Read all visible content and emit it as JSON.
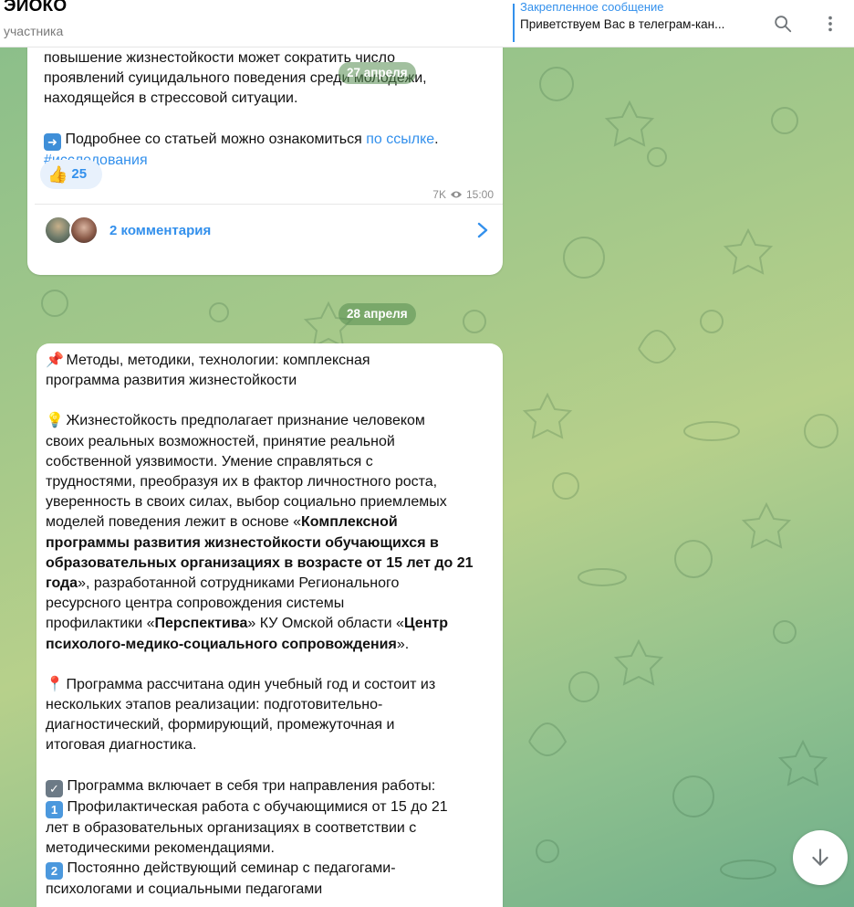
{
  "header": {
    "title": "ЭИОКО",
    "subtitle": "участника",
    "pinned_title": "Закрепленное сообщение",
    "pinned_text": "Приветствуем Вас в телеграм-кан...",
    "icons": [
      "search-icon",
      "more-vert-icon"
    ]
  },
  "message1": {
    "lines": [
      "повышение жизнестойкости может сократить число",
      "проявлений суицидального поведения среди молодежи,",
      "находящейся в стрессовой ситуации."
    ],
    "more_prefix": "Подробнее со статьей можно ознакомиться ",
    "more_link": "по ссылке",
    "more_suffix": ".",
    "hashtag": "#исследования",
    "reaction_emoji": "👍",
    "reaction_count": "25",
    "views": "7K",
    "time": "15:00",
    "comments": "2 комментария"
  },
  "dates": {
    "first": "27 апреля",
    "second": "28 апреля"
  },
  "message2": {
    "title_line1": "Методы, методики, технологии: комплексная",
    "title_line2": "программа развития жизнестойкости",
    "p1": [
      "Жизнестойкость предполагает признание человеком",
      "своих реальных возможностей, принятие реальной",
      "собственной уязвимости. Умение справляться с",
      "трудностями, преобразуя их в фактор личностного роста,",
      "уверенность в своих силах, выбор социально приемлемых"
    ],
    "p1_line6_prefix": "моделей поведения лежит в основе «",
    "p1_bold1": "Комплексной",
    "p1_bold2": "программы развития жизнестойкости обучающихся в",
    "p1_bold3": "образовательных организациях в возрасте от 15 лет до 21",
    "p1_bold4": "года",
    "p1_line9_suffix": "», разработанной сотрудниками Регионального",
    "p1_line10": "ресурсного центра сопровождения системы",
    "p1_line11_prefix": "профилактики «",
    "p1_bold5": "Перспектива",
    "p1_line11_mid": "» КУ Омской области «",
    "p1_bold6": "Центр",
    "p1_bold7": "психолого-медико-социального сопровождения",
    "p1_line12_suffix": "».",
    "p2": [
      "Программа рассчитана один учебный год и состоит из",
      "нескольких этапов реализации: подготовительно-",
      "диагностический, формирующий, промежуточная и",
      "итоговая диагностика."
    ],
    "p3_head": "Программа включает в себя три направления работы:",
    "item1": [
      "Профилактическая работа с обучающимися от 15 до 21",
      "лет в образовательных организациях в соответствии с",
      "методическими рекомендациями."
    ],
    "item2": "Постоянно действующий семинар с педагогами-",
    "item2_cont": "психологами и социальными педагогами"
  }
}
